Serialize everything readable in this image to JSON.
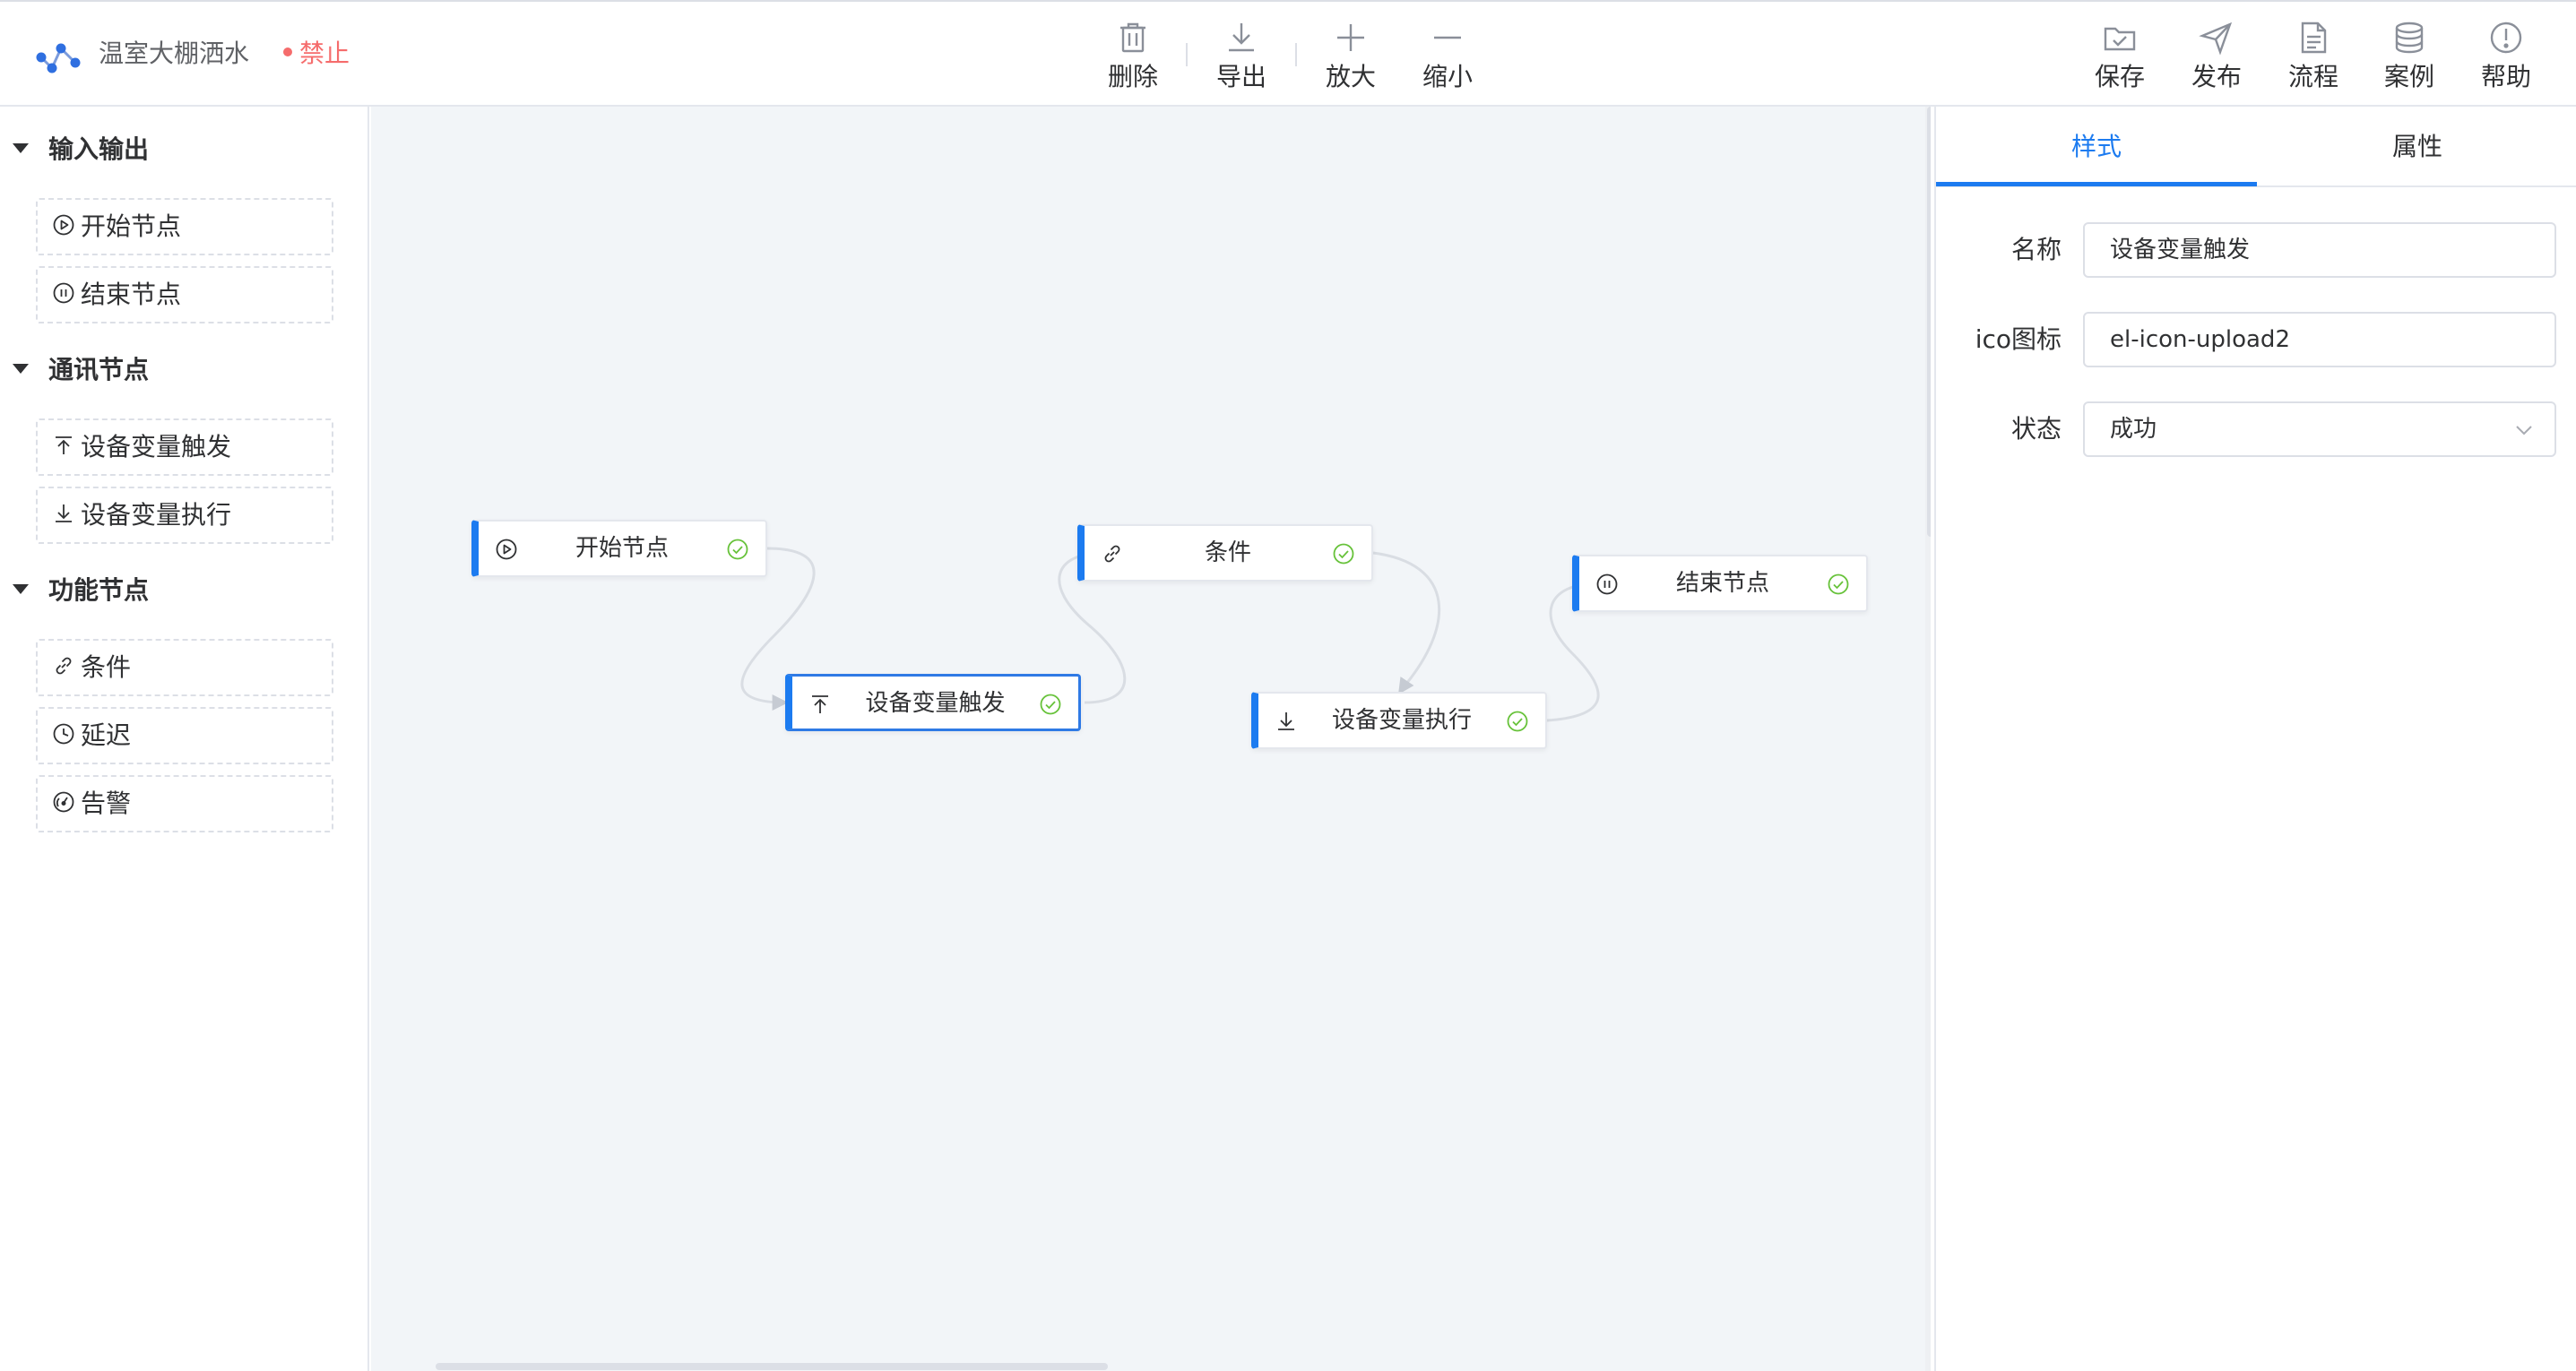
{
  "header": {
    "app_title": "温室大棚洒水",
    "status_label": "禁止",
    "status_color": "#f56c6c",
    "center_tools": [
      {
        "label": "删除",
        "icon": "trash-icon"
      },
      {
        "label": "导出",
        "icon": "download-icon"
      },
      {
        "label": "放大",
        "icon": "plus-icon"
      },
      {
        "label": "缩小",
        "icon": "minus-icon"
      }
    ],
    "right_tools": [
      {
        "label": "保存",
        "icon": "folder-check-icon"
      },
      {
        "label": "发布",
        "icon": "send-icon"
      },
      {
        "label": "流程",
        "icon": "document-icon"
      },
      {
        "label": "案例",
        "icon": "database-icon"
      },
      {
        "label": "帮助",
        "icon": "warning-circle-icon"
      }
    ]
  },
  "palette": {
    "groups": [
      {
        "title": "输入输出",
        "items": [
          {
            "label": "开始节点",
            "icon": "play-circle-icon"
          },
          {
            "label": "结束节点",
            "icon": "pause-circle-icon"
          }
        ]
      },
      {
        "title": "通讯节点",
        "items": [
          {
            "label": "设备变量触发",
            "icon": "upload-icon"
          },
          {
            "label": "设备变量执行",
            "icon": "download-icon"
          }
        ]
      },
      {
        "title": "功能节点",
        "items": [
          {
            "label": "条件",
            "icon": "link-icon"
          },
          {
            "label": "延迟",
            "icon": "clock-icon"
          },
          {
            "label": "告警",
            "icon": "gauge-icon"
          }
        ]
      }
    ]
  },
  "canvas": {
    "nodes": [
      {
        "label": "开始节点",
        "icon": "play-circle-icon",
        "status": "success"
      },
      {
        "label": "设备变量触发",
        "icon": "upload-icon",
        "status": "success",
        "selected": true
      },
      {
        "label": "条件",
        "icon": "link-icon",
        "status": "success"
      },
      {
        "label": "设备变量执行",
        "icon": "download-icon",
        "status": "success"
      },
      {
        "label": "结束节点",
        "icon": "pause-circle-icon",
        "status": "success"
      }
    ],
    "accent_color": "#1c7bf0",
    "success_color": "#67c23a"
  },
  "inspector": {
    "tabs": [
      {
        "label": "样式",
        "active": true
      },
      {
        "label": "属性",
        "active": false
      }
    ],
    "fields": {
      "name": {
        "label": "名称",
        "value": "设备变量触发"
      },
      "icon": {
        "label": "ico图标",
        "value": "el-icon-upload2"
      },
      "state": {
        "label": "状态",
        "value": "成功"
      }
    }
  }
}
